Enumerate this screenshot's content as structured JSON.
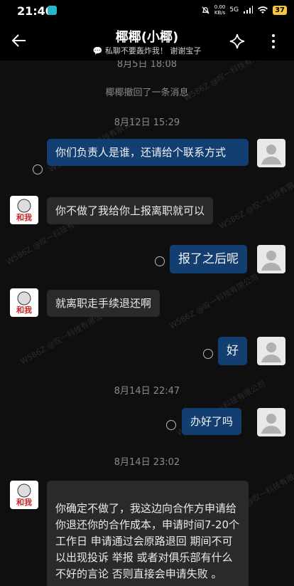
{
  "status_bar": {
    "time": "21:40",
    "net_speed": "0.00",
    "net_unit": "KB/s",
    "signal": "5G",
    "battery": "37"
  },
  "header": {
    "title": "椰椰(小椰)",
    "subtitle": "💬 私聊不要轰炸我！ 谢谢宝子"
  },
  "watermark": "W586Z @叹一科技有限公司",
  "messages": {
    "time1": "8月5日  18:08",
    "recall": "椰椰撤回了一条消息",
    "time2": "8月12日  15:29",
    "m1": "你们负责人是谁，还请给个联系方式",
    "m2": "你不做了我给你上报离职就可以",
    "m3": "报了之后呢",
    "m4": "就离职走手续退还啊",
    "m5": "好",
    "time3": "8月14日  22:47",
    "m6": "办好了吗",
    "time4": "8月14日  23:02",
    "m7": "你确定不做了，我这边向合作方申请给你退还你的合作成本，申请时间7-20个工作日  申请通过会原路退回  期间不可以出现投诉 举报    或者对俱乐部有什么不好的言论  否则直接会申请失败 。"
  },
  "avatar_text": "和我"
}
